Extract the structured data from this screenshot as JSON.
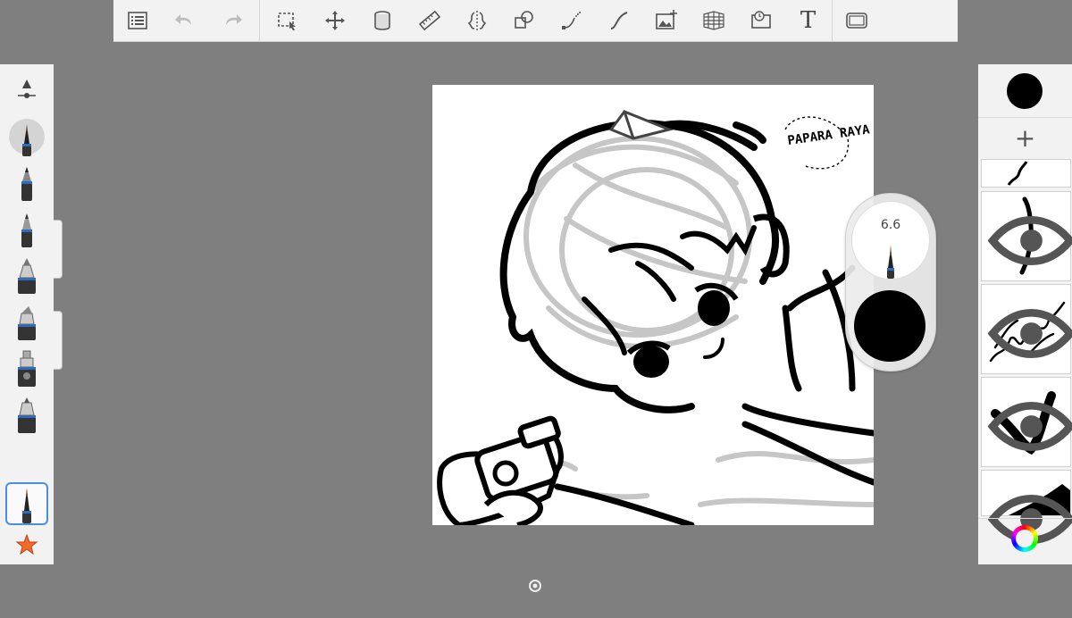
{
  "toolbar": {
    "items": [
      {
        "name": "layers-menu-icon"
      },
      {
        "name": "undo-icon"
      },
      {
        "name": "redo-icon"
      },
      {
        "name": "selection-icon"
      },
      {
        "name": "transform-icon"
      },
      {
        "name": "fill-bucket-icon"
      },
      {
        "name": "ruler-icon"
      },
      {
        "name": "symmetry-icon"
      },
      {
        "name": "shapes-icon"
      },
      {
        "name": "curve-icon"
      },
      {
        "name": "stroke-icon"
      },
      {
        "name": "add-image-icon"
      },
      {
        "name": "perspective-grid-icon"
      },
      {
        "name": "time-lapse-icon"
      },
      {
        "name": "text-icon",
        "label": "T"
      },
      {
        "name": "fullscreen-icon"
      }
    ]
  },
  "brush_palette": {
    "tools": [
      {
        "name": "brush-settings-icon"
      },
      {
        "name": "paintbrush-tool-icon"
      },
      {
        "name": "pencil-tool-icon"
      },
      {
        "name": "ballpoint-pen-tool-icon"
      },
      {
        "name": "marker-tool-icon"
      },
      {
        "name": "chisel-marker-tool-icon"
      },
      {
        "name": "airbrush-tool-icon"
      },
      {
        "name": "inking-tool-icon"
      },
      {
        "name": "fine-brush-tool-icon",
        "selected": true
      },
      {
        "name": "favorite-star-icon"
      }
    ],
    "star_color": "#f26b2a",
    "selection_color": "#4a90e2"
  },
  "brush_puck": {
    "size_value": "6.6",
    "color": "#000000"
  },
  "layers": {
    "current_color": "#000000",
    "add_label": "+",
    "thumbnails": [
      {
        "name": "layer-thumbnail-1"
      },
      {
        "name": "layer-thumbnail-2"
      },
      {
        "name": "layer-thumbnail-3"
      },
      {
        "name": "layer-thumbnail-4"
      },
      {
        "name": "layer-thumbnail-5"
      }
    ]
  },
  "canvas": {
    "signature_text": "PAPARA RAYA"
  }
}
